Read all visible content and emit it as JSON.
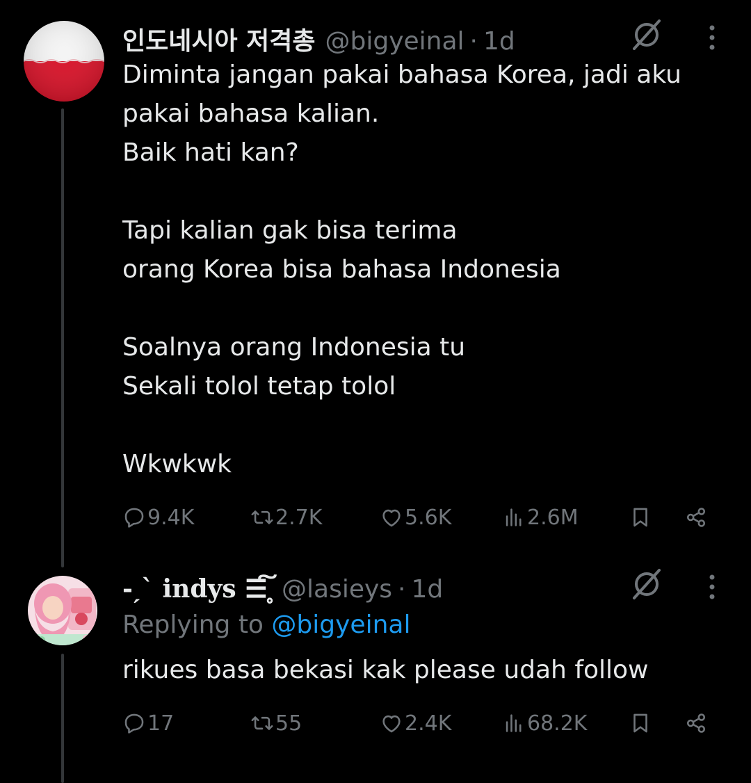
{
  "tweets": [
    {
      "name": "인도네시아 저격총",
      "handle": "@bigyeinal",
      "separator": "·",
      "time": "1d",
      "text": "Diminta jangan pakai bahasa Korea, jadi aku\npakai bahasa kalian.\nBaik hati kan?\n\nTapi kalian gak bisa terima\norang Korea bisa bahasa Indonesia\n\nSoalnya orang Indonesia tu\nSekali tolol tetap tolol\n\nWkwkwk",
      "stats": {
        "replies": "9.4K",
        "reposts": "2.7K",
        "likes": "5.6K",
        "views": "2.6M"
      },
      "avatar": "indonesia-flag"
    },
    {
      "name": "-ˏˋ indys ☰͠ ̥̥",
      "handle": "@lasieys",
      "separator": "·",
      "time": "1d",
      "reply_prefix": "Replying to ",
      "reply_mention": "@bigyeinal",
      "text": "rikues basa bekasi kak please udah follow",
      "stats": {
        "replies": "17",
        "reposts": "55",
        "likes": "2.4K",
        "views": "68.2K"
      },
      "avatar": "pink-hair-photo"
    }
  ],
  "colors": {
    "background": "#000000",
    "text": "#e7e9ea",
    "muted": "#71767b",
    "link": "#1d9bf0",
    "flag_red": "#d8142a"
  },
  "icons": [
    "grok-icon",
    "more-icon",
    "reply-icon",
    "repost-icon",
    "like-icon",
    "views-icon",
    "bookmark-icon",
    "share-icon"
  ]
}
